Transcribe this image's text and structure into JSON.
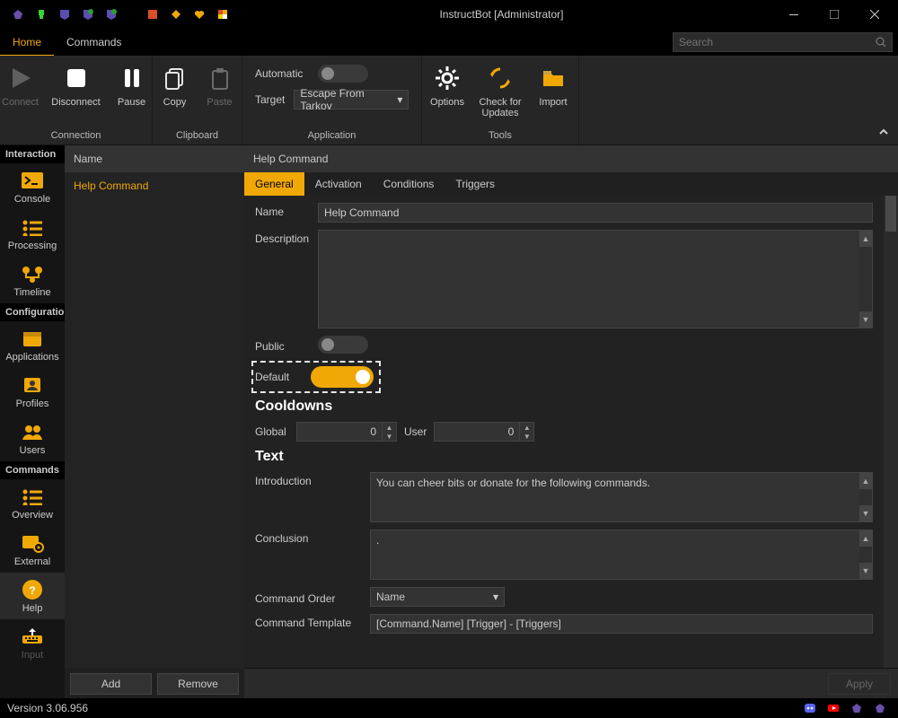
{
  "window": {
    "title": "InstructBot [Administrator]"
  },
  "tabs": {
    "home": "Home",
    "commands": "Commands"
  },
  "search": {
    "placeholder": "Search"
  },
  "ribbon": {
    "connection": {
      "label": "Connection",
      "connect": "Connect",
      "disconnect": "Disconnect",
      "pause": "Pause"
    },
    "clipboard": {
      "label": "Clipboard",
      "copy": "Copy",
      "paste": "Paste"
    },
    "application": {
      "label": "Application",
      "automatic": "Automatic",
      "target": "Target",
      "target_value": "Escape From Tarkov"
    },
    "tools": {
      "label": "Tools",
      "options": "Options",
      "check_updates": "Check for Updates",
      "import": "Import"
    }
  },
  "sidebar": {
    "interaction": "Interaction",
    "console": "Console",
    "processing": "Processing",
    "timeline": "Timeline",
    "configuration": "Configuration",
    "applications": "Applications",
    "profiles": "Profiles",
    "users": "Users",
    "commands": "Commands",
    "overview": "Overview",
    "external": "External",
    "help": "Help",
    "input": "Input"
  },
  "listcol": {
    "header": "Name",
    "item0": "Help Command",
    "add": "Add",
    "remove": "Remove"
  },
  "detail": {
    "header": "Help Command",
    "tabs": {
      "general": "General",
      "activation": "Activation",
      "conditions": "Conditions",
      "triggers": "Triggers"
    },
    "name_label": "Name",
    "name_value": "Help Command",
    "description_label": "Description",
    "description_value": "",
    "public_label": "Public",
    "default_label": "Default",
    "cooldowns_title": "Cooldowns",
    "global_label": "Global",
    "global_value": "0",
    "user_label": "User",
    "user_value": "0",
    "text_title": "Text",
    "introduction_label": "Introduction",
    "introduction_value": "You can cheer bits or donate for the following commands.",
    "conclusion_label": "Conclusion",
    "conclusion_value": ".",
    "command_order_label": "Command Order",
    "command_order_value": "Name",
    "command_template_label": "Command Template",
    "command_template_value": "[Command.Name] [Trigger] - [Triggers]",
    "apply": "Apply"
  },
  "status": {
    "version": "Version 3.06.956"
  },
  "colors": {
    "accent": "#f0a806"
  }
}
